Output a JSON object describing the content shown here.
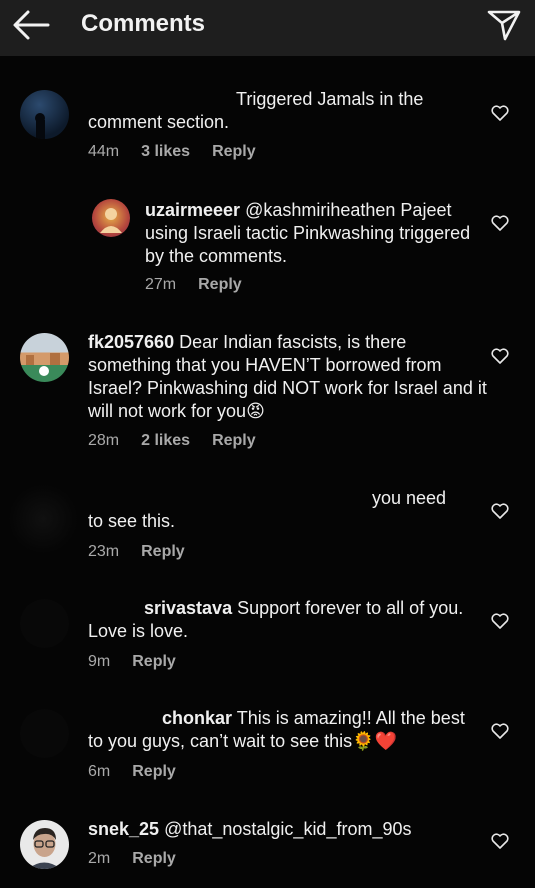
{
  "header": {
    "title": "Comments"
  },
  "comments": [
    {
      "username": "",
      "text": "Triggered Jamals in the comment section.",
      "time": "44m",
      "likes": "3 likes",
      "reply": "Reply"
    },
    {
      "username": "uzairmeeer",
      "text": "@kashmiriheathen Pajeet using Israeli tactic Pinkwashing triggered by the comments.",
      "time": "27m",
      "likes": "",
      "reply": "Reply"
    },
    {
      "username": "fk2057660",
      "text": "Dear Indian fascists, is there something that you HAVEN’T borrowed from Israel? Pinkwashing did NOT work for Israel and it will not work for you",
      "emoji": "😡",
      "time": "28m",
      "likes": "2 likes",
      "reply": "Reply"
    },
    {
      "username": "",
      "text": "you need to see this.",
      "time": "23m",
      "likes": "",
      "reply": "Reply"
    },
    {
      "username": "srivastava",
      "text": "Support forever to all of you. Love is love.",
      "time": "9m",
      "likes": "",
      "reply": "Reply"
    },
    {
      "username": "chonkar",
      "text": "This is amazing!! All the best to you guys, can’t wait to see this",
      "emoji": "🌻❤️",
      "time": "6m",
      "likes": "",
      "reply": "Reply"
    },
    {
      "username": "snek_25",
      "text": "@that_nostalgic_kid_from_90s",
      "time": "2m",
      "likes": "",
      "reply": "Reply"
    }
  ]
}
